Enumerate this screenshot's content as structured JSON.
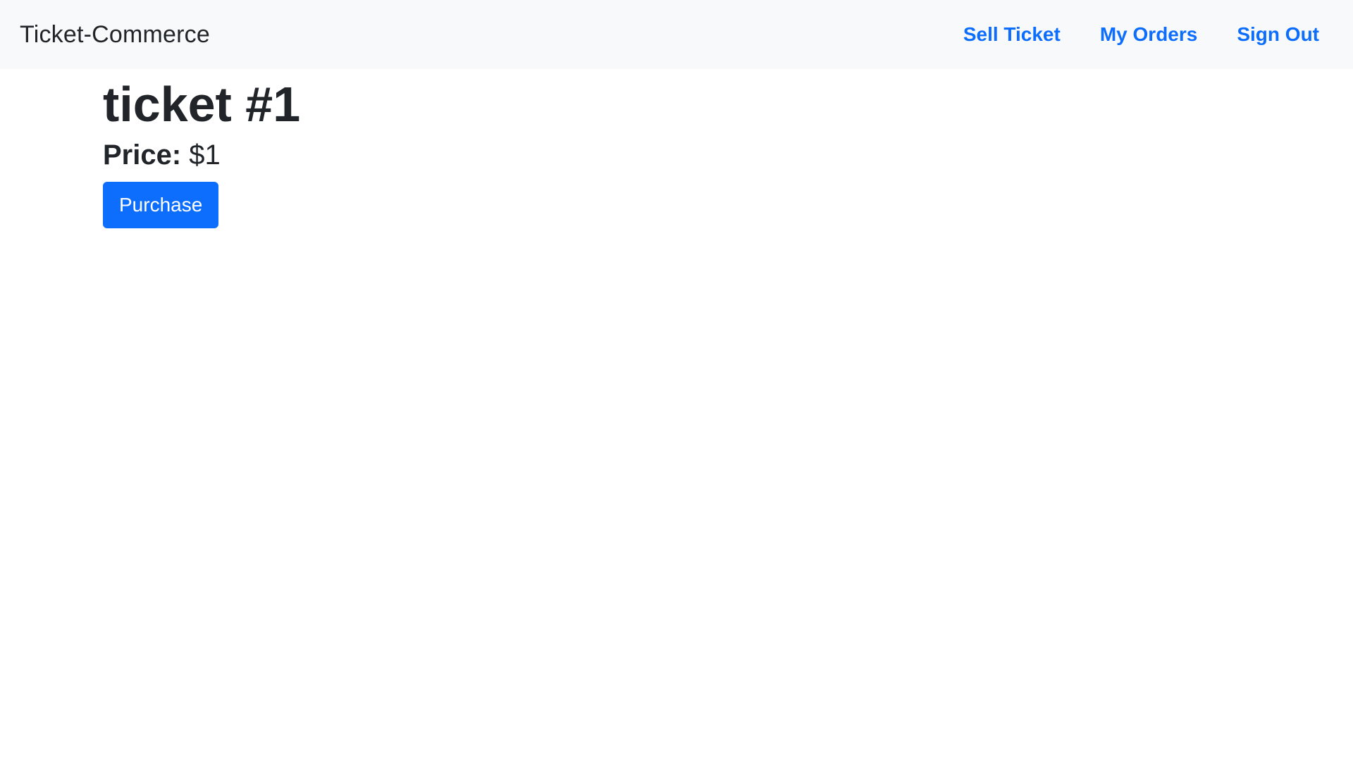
{
  "navbar": {
    "brand": "Ticket-Commerce",
    "links": [
      {
        "label": "Sell Ticket"
      },
      {
        "label": "My Orders"
      },
      {
        "label": "Sign Out"
      }
    ]
  },
  "ticket": {
    "title": "ticket #1",
    "price_label": "Price:",
    "price_value": "$1",
    "purchase_label": "Purchase"
  },
  "colors": {
    "navbar_background": "#f8f9fa",
    "link": "#0d6efd",
    "button_background": "#0d6efd",
    "text": "#212529"
  }
}
